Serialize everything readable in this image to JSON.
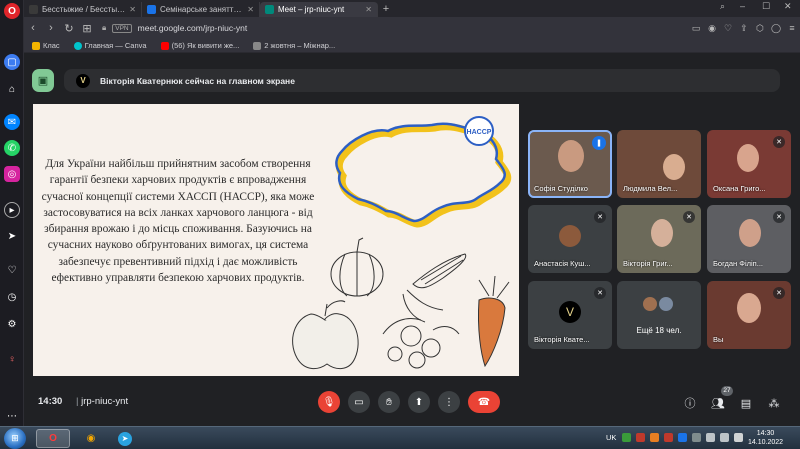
{
  "browser": {
    "tabs": [
      {
        "label": "Бесстыжие / Бесстыдники",
        "favicon_color": "#3a3a3a"
      },
      {
        "label": "Семінарське заняття №2 Т",
        "favicon_color": "#1a73e8"
      },
      {
        "label": "Meet – jrp-niuc-ynt",
        "favicon_color": "#00897b"
      }
    ],
    "url": "meet.google.com/jrp-niuc-ynt",
    "vpn_label": "VPN",
    "bookmarks": [
      {
        "label": "Клас",
        "icon_color": "#f4b400"
      },
      {
        "label": "Главная — Canva",
        "icon_color": "#00c4cc"
      },
      {
        "label": "(56) Як вивити же...",
        "icon_color": "#ff0000"
      },
      {
        "label": "2 жовтня – Міжнар...",
        "icon_color": "#888888"
      }
    ]
  },
  "meet": {
    "banner": "Вікторія Кватернюк сейчас на главном экране",
    "banner_avatar": "V",
    "slide": {
      "text": "Для України найбільш прийнятним засобом створення гарантії безпеки харчових продуктів є впровадження сучасної концепції системи ХАССП (НАССР), яка може застосовуватися на всіх ланках харчового ланцюга - від збирання врожаю і до місць споживання. Базуючись на сучасних науково обґрунтованих вимогах, ця система забезпечує превентивний підхід і дає можливість ефективно управляти безпекою харчових продуктів.",
      "seal_label": "HACCP"
    },
    "participants": [
      {
        "name": "Софія Студілко",
        "speaking": true
      },
      {
        "name": "Людмила Вел...",
        "speaking": false
      },
      {
        "name": "Оксана Григо...",
        "speaking": false
      },
      {
        "name": "Анастасія Куш...",
        "speaking": false
      },
      {
        "name": "Вікторія Григ...",
        "speaking": false
      },
      {
        "name": "Богдан Філіп...",
        "speaking": false
      },
      {
        "name": "Вікторія Квате...",
        "speaking": false
      },
      {
        "name": "Ещё 18 чел.",
        "speaking": false
      },
      {
        "name": "Вы",
        "speaking": false
      }
    ],
    "time": "14:30",
    "meeting_code": "jrp-niuc-ynt",
    "people_count": "27"
  },
  "taskbar": {
    "lang": "UK",
    "clock_time": "14:30",
    "clock_date": "14.10.2022"
  }
}
